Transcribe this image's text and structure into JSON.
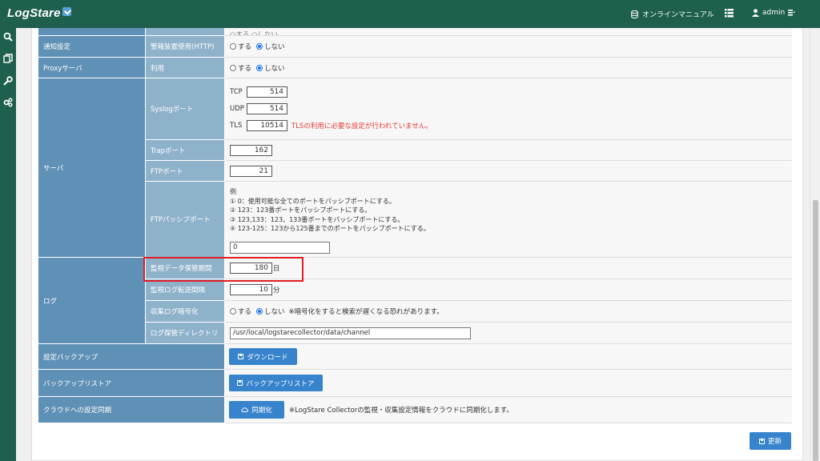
{
  "header": {
    "logo": "LogStare",
    "manual": "オンラインマニュアル",
    "user": "admin"
  },
  "rows": {
    "partial_above": "○する ○しない",
    "notify": {
      "group": "通知設定",
      "sub": "警報装置使用(HTTP)",
      "on": "する",
      "off": "しない"
    },
    "proxy": {
      "group": "Proxyサーバ",
      "sub": "利用",
      "on": "する",
      "off": "しない"
    },
    "server": {
      "group": "サーバ",
      "syslog_label": "Syslogポート",
      "tcp_label": "TCP",
      "tcp_value": "514",
      "udp_label": "UDP",
      "udp_value": "514",
      "tls_label": "TLS",
      "tls_value": "10514",
      "tls_warning": "TLSの利用に必要な設定が行われていません。",
      "trap_label": "Trapポート",
      "trap_value": "162",
      "ftp_label": "FTPポート",
      "ftp_value": "21",
      "passive_label": "FTPパッシブポート",
      "passive_help": [
        "例",
        "① 0：使用可能な全てのポートをパッシブポートにする。",
        "② 123：123番ポートをパッシブポートにする。",
        "③ 123,133：123、133番ポートをパッシブポートにする。",
        "④ 123-125：123から125番までのポートをパッシブポートにする。"
      ],
      "passive_value": "0"
    },
    "log": {
      "group": "ログ",
      "retention_label": "監視データ保管期間",
      "retention_value": "180",
      "retention_unit": "日",
      "transfer_label": "監視ログ転送間隔",
      "transfer_value": "10",
      "transfer_unit": "分",
      "encrypt_label": "収集ログ暗号化",
      "encrypt_on": "する",
      "encrypt_off": "しない",
      "encrypt_note": "※暗号化をすると検索が遅くなる恐れがあります。",
      "dir_label": "ログ保管ディレクトリ",
      "dir_value": "/usr/local/logstarecollector/data/channel"
    },
    "backup": {
      "label": "設定バックアップ",
      "button": "ダウンロード"
    },
    "restore": {
      "label": "バックアップリストア",
      "button": "バックアップリストア"
    },
    "cloud": {
      "label": "クラウドへの設定同期",
      "button": "同期化",
      "note": "※LogStare Collectorの監視・収集設定情報をクラウドに同期化します。"
    }
  },
  "footer": {
    "update_button": "更新"
  },
  "colors": {
    "header": "#1e5f4e",
    "group_cell": "#5f90b5",
    "sub_cell": "#8fb2cb",
    "button": "#3784cc",
    "highlight": "#e01e25"
  }
}
